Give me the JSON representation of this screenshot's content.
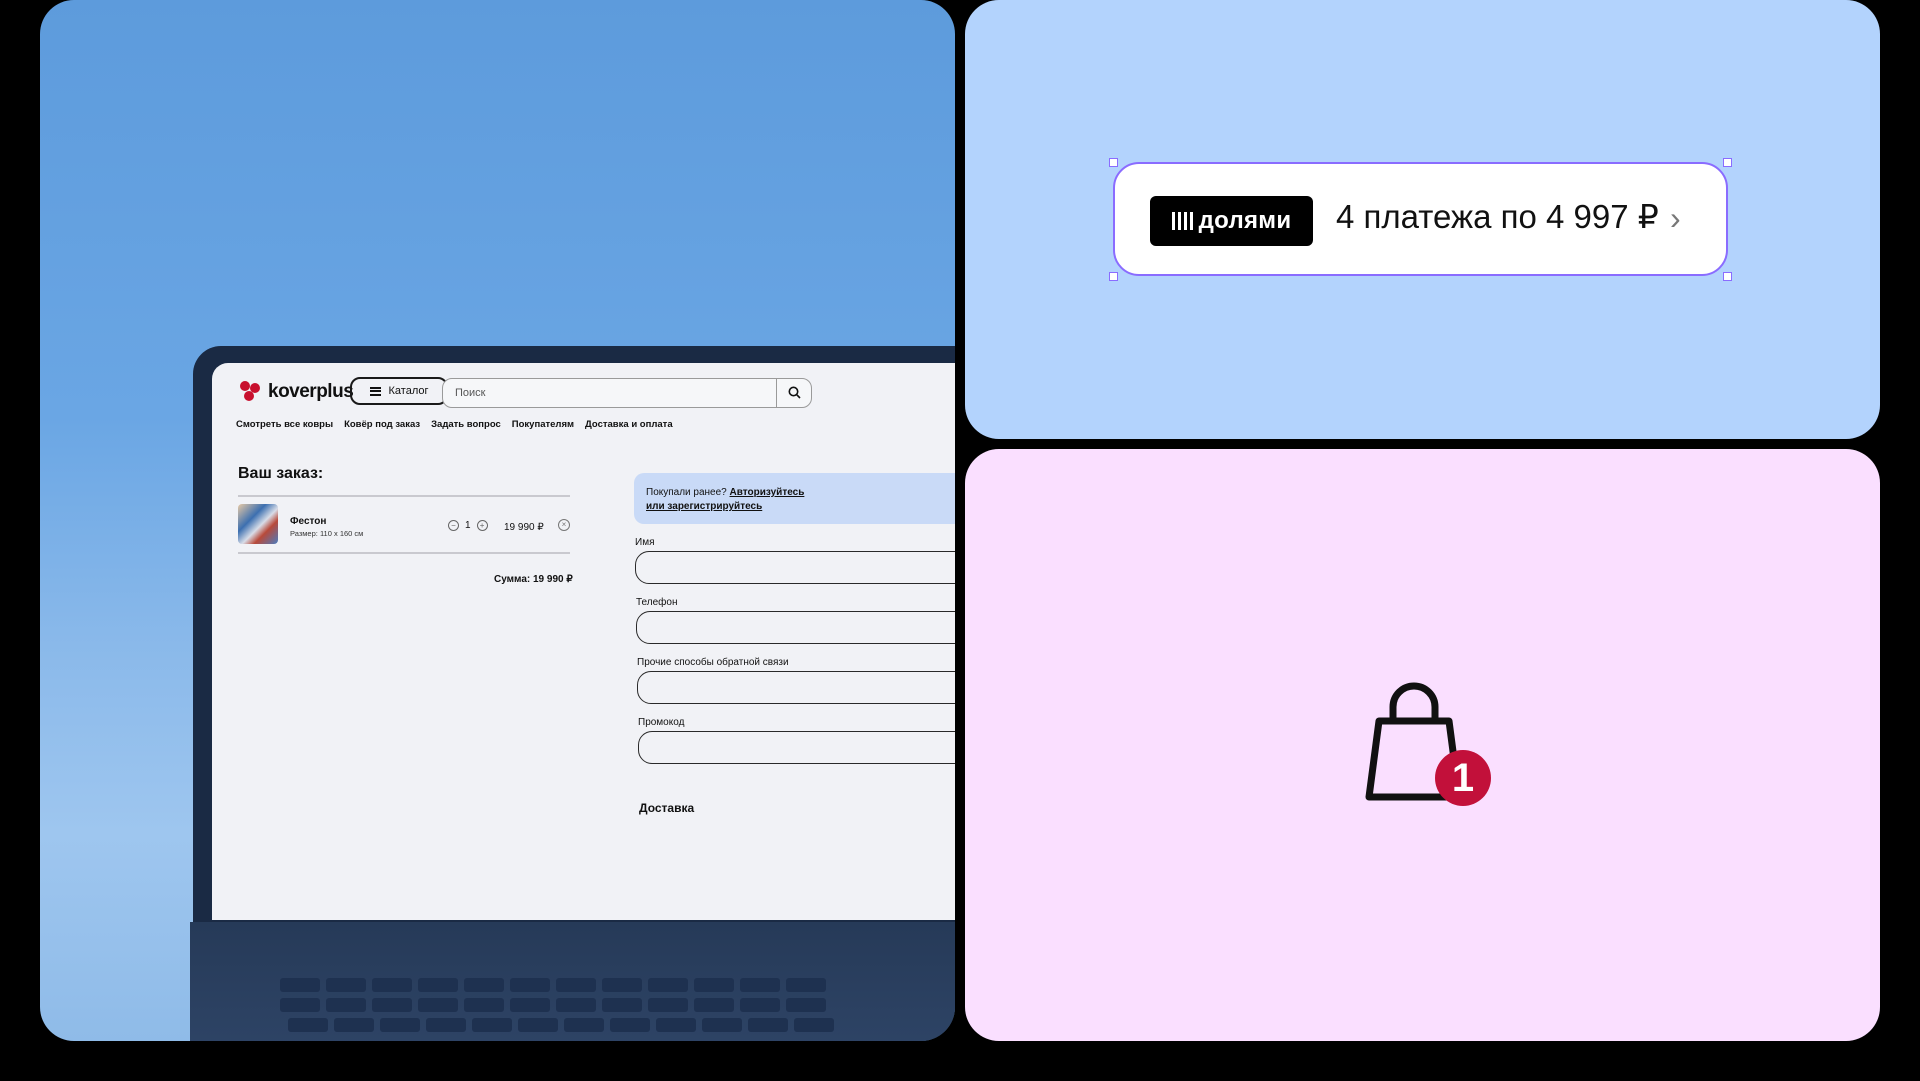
{
  "site": {
    "logo_text": "koverplus",
    "catalog_label": "Каталог",
    "search_placeholder": "Поиск",
    "nav": [
      "Смотреть все ковры",
      "Ковёр под заказ",
      "Задать вопрос",
      "Покупателям",
      "Доставка и оплата"
    ],
    "order_title": "Ваш заказ:",
    "product": {
      "name": "Фестон",
      "size": "Размер: 110 х 160 см",
      "quantity": "1",
      "price": "19 990 ₽"
    },
    "sum": "Сумма: 19 990 ₽",
    "login_prompt": "Покупали ранее?",
    "login_link": "Авторизуйтесь или зарегистрируйтесь",
    "fields": [
      "Имя",
      "Телефон",
      "Прочие способы обратной связи",
      "Промокод"
    ],
    "delivery_heading": "Доставка"
  },
  "dolyami": {
    "brand": "долями",
    "payment_text": "4 платежа по 4 997 ₽",
    "chevron": "›"
  },
  "cart": {
    "icon": "shopping-bag-icon",
    "badge_count": "1"
  },
  "colors": {
    "brand_red": "#c8102e",
    "selection_purple": "#8a6cff",
    "badge_red": "#c2103a",
    "panel_blue": "#b3d3fd",
    "panel_pink": "#fadfff"
  }
}
